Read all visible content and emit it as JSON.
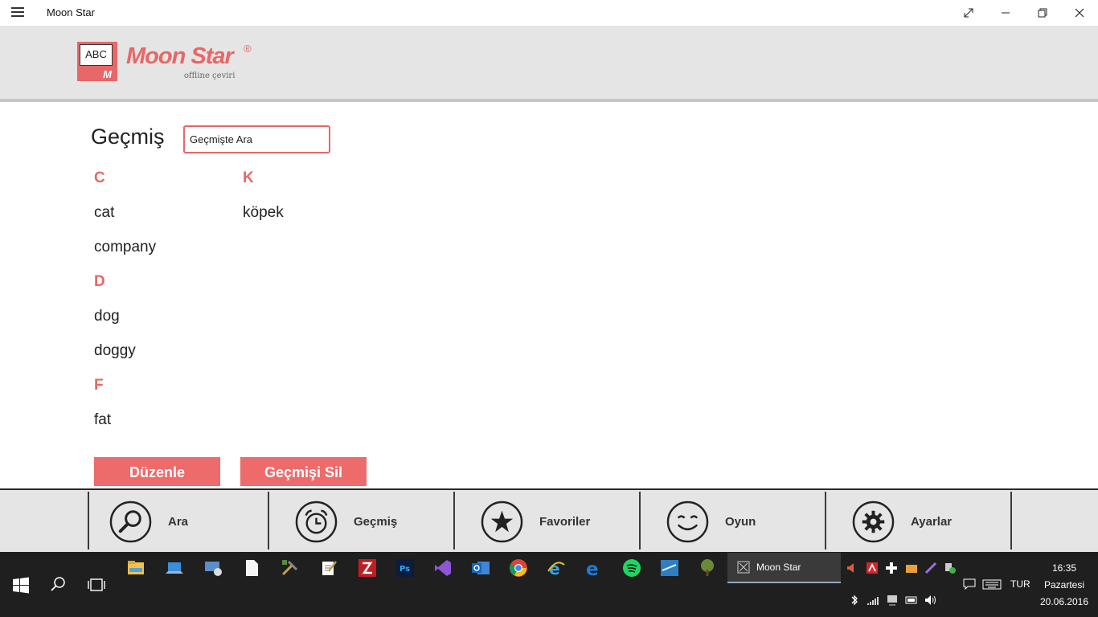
{
  "window": {
    "title": "Moon Star"
  },
  "brand": {
    "logo_text": "ABC",
    "logo_mark": "M",
    "name": "Moon Star",
    "registered": "®",
    "tagline": "offline çeviri",
    "accent_color": "#e86767"
  },
  "history": {
    "title": "Geçmiş",
    "search_placeholder": "Geçmişte Ara",
    "column_1": [
      {
        "kind": "letter",
        "text": "C"
      },
      {
        "kind": "word",
        "text": "cat"
      },
      {
        "kind": "word",
        "text": "company"
      },
      {
        "kind": "letter",
        "text": "D"
      },
      {
        "kind": "word",
        "text": "dog"
      },
      {
        "kind": "word",
        "text": "doggy"
      },
      {
        "kind": "letter",
        "text": "F"
      },
      {
        "kind": "word",
        "text": "fat"
      }
    ],
    "column_2": [
      {
        "kind": "letter",
        "text": "K"
      },
      {
        "kind": "word",
        "text": "köpek"
      }
    ],
    "edit_button": "Düzenle",
    "clear_button": "Geçmişi Sil"
  },
  "nav": {
    "items": [
      {
        "label": "Ara",
        "icon": "search-icon"
      },
      {
        "label": "Geçmiş",
        "icon": "alarm-clock-icon"
      },
      {
        "label": "Favoriler",
        "icon": "star-icon"
      },
      {
        "label": "Oyun",
        "icon": "smiley-icon"
      },
      {
        "label": "Ayarlar",
        "icon": "gear-icon"
      }
    ]
  },
  "taskbar": {
    "running_app": "Moon Star",
    "language": "TUR",
    "time": "16:35",
    "day": "Pazartesi",
    "date": "20.06.2016"
  }
}
